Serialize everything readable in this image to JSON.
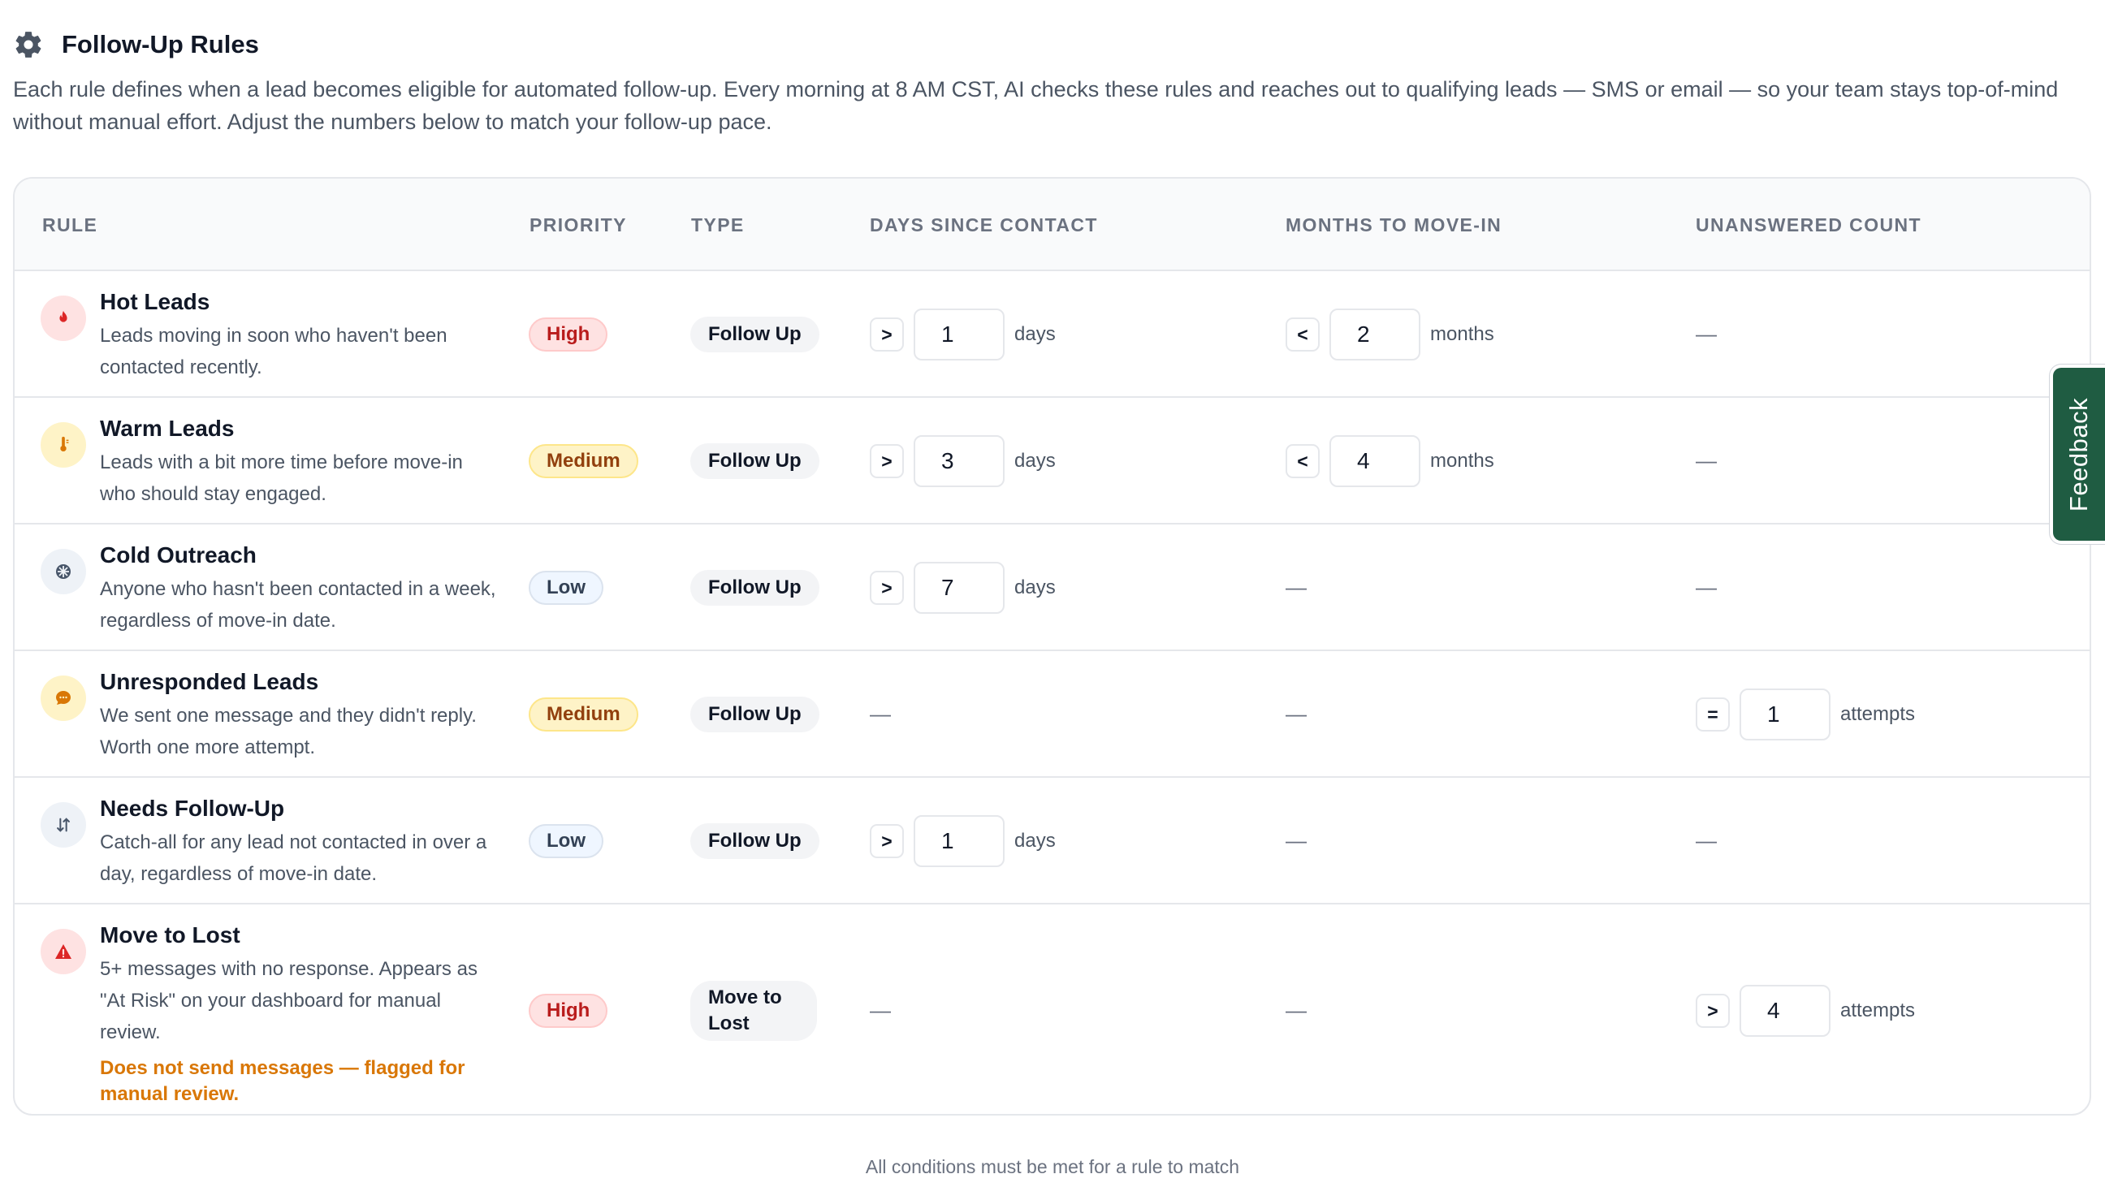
{
  "header": {
    "title": "Follow-Up Rules",
    "description": "Each rule defines when a lead becomes eligible for automated follow-up. Every morning at 8 AM CST, AI checks these rules and reaches out to qualifying leads — SMS or email — so your team stays top-of-mind without manual effort. Adjust the numbers below to match your follow-up pace."
  },
  "columns": {
    "rule": "RULE",
    "priority": "PRIORITY",
    "type": "TYPE",
    "days": "DAYS SINCE CONTACT",
    "months": "MONTHS TO MOVE-IN",
    "unanswered": "UNANSWERED COUNT"
  },
  "rows": [
    {
      "name": "Hot Leads",
      "description": "Leads moving in soon who haven't been contacted recently.",
      "icon": "flame-icon",
      "priority": "High",
      "type": "Follow Up",
      "days": {
        "op": ">",
        "value": "1",
        "unit": "days"
      },
      "months": {
        "op": "<",
        "value": "2",
        "unit": "months"
      },
      "unanswered": "—"
    },
    {
      "name": "Warm Leads",
      "description": "Leads with a bit more time before move-in who should stay engaged.",
      "icon": "thermometer-icon",
      "priority": "Medium",
      "type": "Follow Up",
      "days": {
        "op": ">",
        "value": "3",
        "unit": "days"
      },
      "months": {
        "op": "<",
        "value": "4",
        "unit": "months"
      },
      "unanswered": "—"
    },
    {
      "name": "Cold Outreach",
      "description": "Anyone who hasn't been contacted in a week, regardless of move-in date.",
      "icon": "snowflake-icon",
      "priority": "Low",
      "type": "Follow Up",
      "days": {
        "op": ">",
        "value": "7",
        "unit": "days"
      },
      "months": "—",
      "unanswered": "—"
    },
    {
      "name": "Unresponded Leads",
      "description": "We sent one message and they didn't reply. Worth one more attempt.",
      "icon": "chat-bubble-icon",
      "priority": "Medium",
      "type": "Follow Up",
      "days": "—",
      "months": "—",
      "unanswered": {
        "op": "=",
        "value": "1",
        "unit": "attempts"
      }
    },
    {
      "name": "Needs Follow-Up",
      "description": "Catch-all for any lead not contacted in over a day, regardless of move-in date.",
      "icon": "arrows-up-down-icon",
      "priority": "Low",
      "type": "Follow Up",
      "days": {
        "op": ">",
        "value": "1",
        "unit": "days"
      },
      "months": "—",
      "unanswered": "—"
    },
    {
      "name": "Move to Lost",
      "description": "5+ messages with no response. Appears as \"At Risk\" on your dashboard for manual review.",
      "warning": "Does not send messages — flagged for manual review.",
      "icon": "warning-triangle-icon",
      "priority": "High",
      "type": "Move to Lost",
      "days": "—",
      "months": "—",
      "unanswered": {
        "op": ">",
        "value": "4",
        "unit": "attempts"
      }
    }
  ],
  "footer": {
    "note": "All conditions must be met for a rule to match"
  },
  "feedback_tab": {
    "label": "Feedback"
  },
  "colors": {
    "high": "#b91c1c",
    "medium": "#92400e",
    "low": "#334155",
    "warning": "#d97706",
    "feedback": "#1f5c42"
  }
}
